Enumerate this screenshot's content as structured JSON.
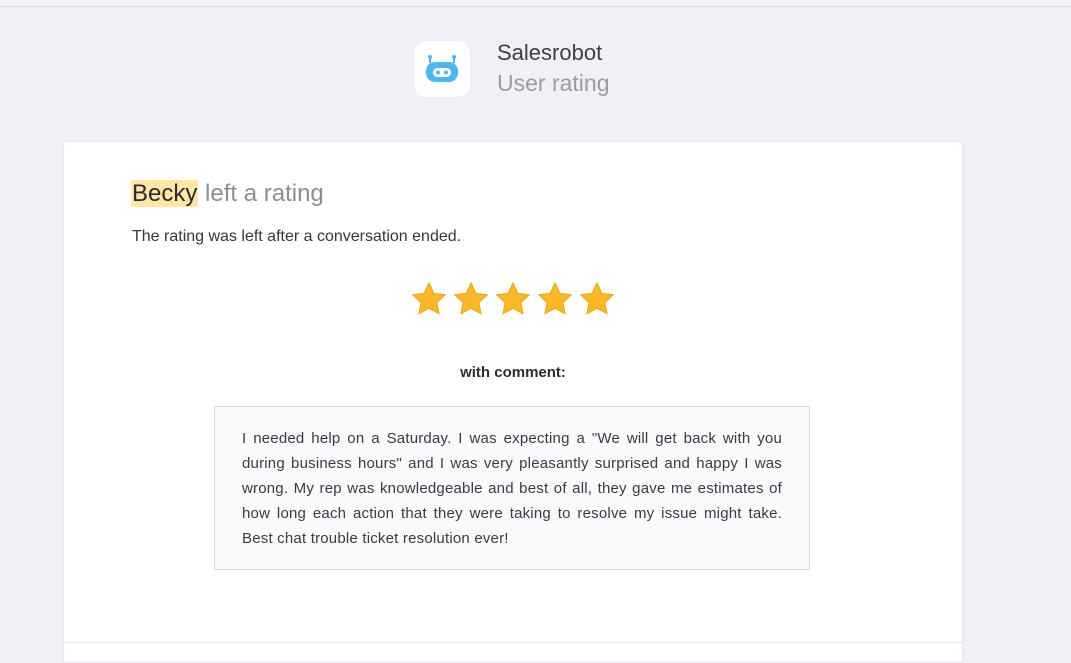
{
  "header": {
    "app_name": "Salesrobot",
    "subtitle": "User rating",
    "icon": "robot-icon"
  },
  "rating": {
    "rater_name": "Becky",
    "title_suffix": " left a rating",
    "description": "The rating was left after a conversation ended.",
    "stars": 5,
    "max_stars": 5,
    "star_color": "#f8b82a",
    "comment_label": "with comment:",
    "comment": "I needed help on a Saturday. I was expecting a \"We will get back with you during business hours\" and I was very pleasantly surprised and happy I was wrong. My rep was knowledgeable and best of all, they gave me estimates of how long each action that they were taking to resolve my issue might take. Best chat trouble ticket resolution ever!"
  },
  "colors": {
    "background": "#f0f0f6",
    "highlight": "#ffe7a6",
    "robot_blue": "#4fb7ec"
  }
}
